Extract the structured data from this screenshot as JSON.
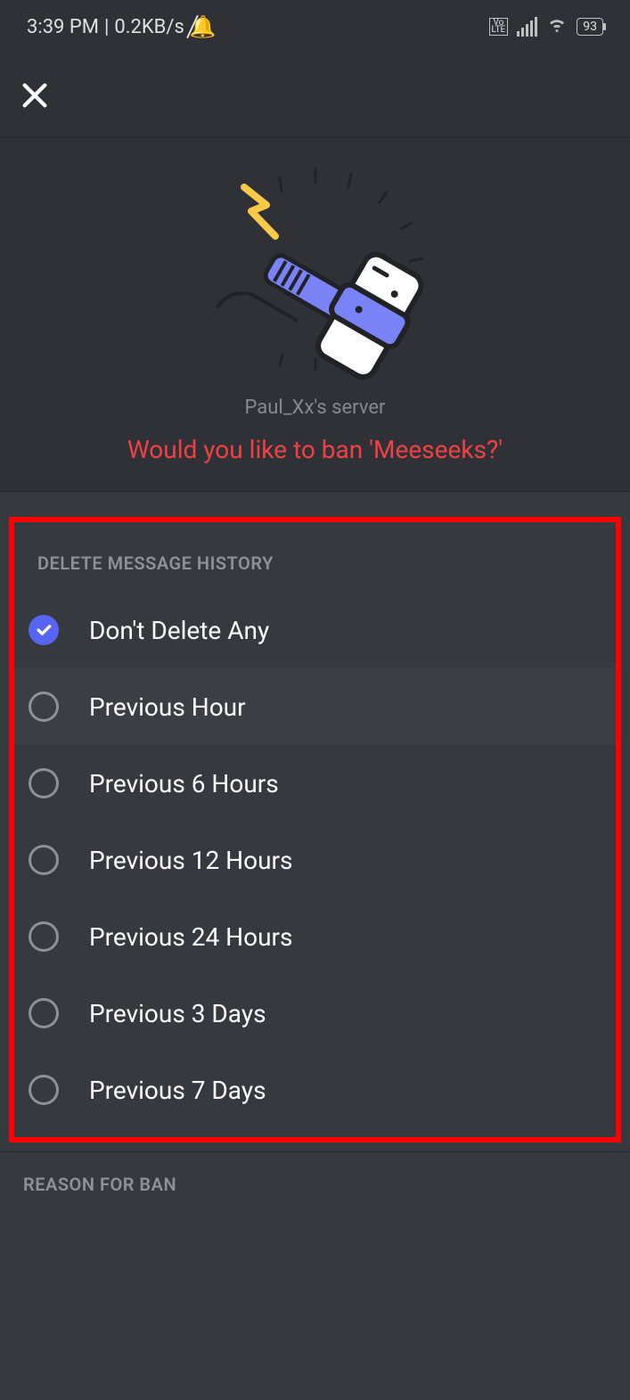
{
  "status": {
    "time": "3:39 PM",
    "sep": "|",
    "net_speed": "0.2KB/s",
    "battery": "93",
    "lte": "Vo\nLTE"
  },
  "hero": {
    "server_name": "Paul_Xx's server",
    "question": "Would you like to ban 'Meeseeks?'"
  },
  "delete_section": {
    "header": "DELETE MESSAGE HISTORY",
    "options": [
      {
        "label": "Don't Delete Any",
        "selected": true
      },
      {
        "label": "Previous Hour",
        "selected": false,
        "highlighted": true
      },
      {
        "label": "Previous 6 Hours",
        "selected": false
      },
      {
        "label": "Previous 12 Hours",
        "selected": false
      },
      {
        "label": "Previous 24 Hours",
        "selected": false
      },
      {
        "label": "Previous 3 Days",
        "selected": false
      },
      {
        "label": "Previous 7 Days",
        "selected": false
      }
    ]
  },
  "reason_section": {
    "header": "REASON FOR BAN"
  }
}
